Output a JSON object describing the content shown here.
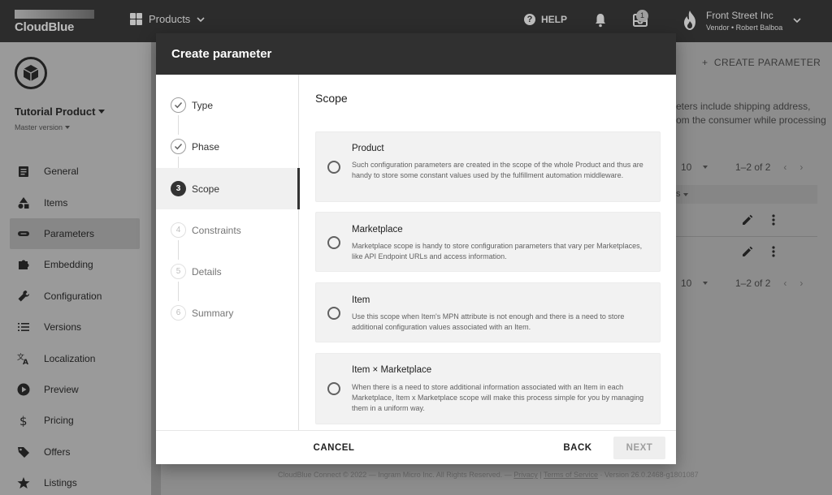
{
  "topbar": {
    "brand": "CloudBlue",
    "nav_label": "Products",
    "help_label": "HELP",
    "inbox_count": "1",
    "account_name": "Front Street Inc",
    "account_sub": "Vendor • Robert Balboa"
  },
  "sidebar": {
    "product_name": "Tutorial Product",
    "version": "Master version",
    "items": [
      {
        "label": "General",
        "icon": "clipboard-icon"
      },
      {
        "label": "Items",
        "icon": "shapes-icon"
      },
      {
        "label": "Parameters",
        "icon": "link-icon",
        "active": true
      },
      {
        "label": "Embedding",
        "icon": "puzzle-icon"
      },
      {
        "label": "Configuration",
        "icon": "wrench-icon"
      },
      {
        "label": "Versions",
        "icon": "list-icon"
      },
      {
        "label": "Localization",
        "icon": "translate-icon"
      },
      {
        "label": "Preview",
        "icon": "play-icon"
      },
      {
        "label": "Pricing",
        "icon": "dollar-icon"
      },
      {
        "label": "Offers",
        "icon": "tag-icon"
      },
      {
        "label": "Listings",
        "icon": "star-icon"
      }
    ]
  },
  "background": {
    "create_button": "CREATE PARAMETER",
    "desc_line1": "eters include shipping address,",
    "desc_line2": "om the consumer while processing",
    "rows_per_page": "10",
    "range": "1–2 of 2",
    "column_header_fragment": "s",
    "footer_text": "CloudBlue Connect © 2022 — Ingram Micro Inc. All Rights Reserved. —",
    "footer_privacy": "Privacy",
    "footer_terms": "Terms of Service",
    "footer_version": "· Version 26.0.2468-g1801087"
  },
  "dialog": {
    "title": "Create parameter",
    "steps": [
      {
        "label": "Type",
        "status": "done",
        "mark": ""
      },
      {
        "label": "Phase",
        "status": "done",
        "mark": ""
      },
      {
        "label": "Scope",
        "status": "current",
        "mark": "3"
      },
      {
        "label": "Constraints",
        "status": "todo",
        "mark": "4"
      },
      {
        "label": "Details",
        "status": "todo",
        "mark": "5"
      },
      {
        "label": "Summary",
        "status": "todo",
        "mark": "6"
      }
    ],
    "content_title": "Scope",
    "options": [
      {
        "title": "Product",
        "description": "Such configuration parameters are created in the scope of the whole Product and thus are handy to store some constant values used by the fulfillment automation middleware."
      },
      {
        "title": "Marketplace",
        "description": "Marketplace scope is handy to store configuration parameters that vary per Marketplaces, like API Endpoint URLs and access information."
      },
      {
        "title": "Item",
        "description": "Use this scope when Item's MPN attribute is not enough and there is a need to store additional configuration values associated with an Item."
      },
      {
        "title": "Item × Marketplace",
        "description": "When there is a need to store additional information associated with an Item in each Marketplace, Item x Marketplace scope will make this process simple for you by managing them in a uniform way."
      }
    ],
    "cancel_label": "CANCEL",
    "back_label": "BACK",
    "next_label": "NEXT"
  },
  "colors": {
    "topbar": "#2c2c2c",
    "dialog_header": "#303030",
    "overlay": "#8d8d8d",
    "option_bg": "#f2f2f2"
  }
}
